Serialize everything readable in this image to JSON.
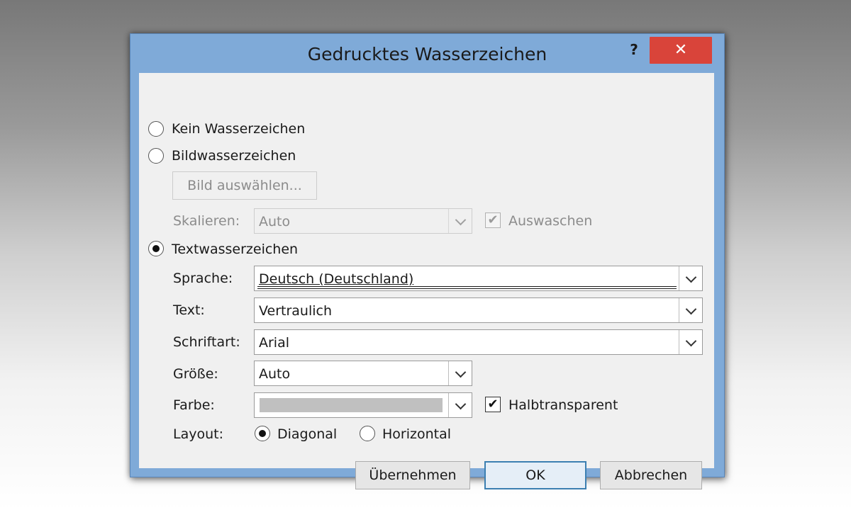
{
  "dialog": {
    "title": "Gedrucktes Wasserzeichen",
    "help": "?",
    "close": "✕"
  },
  "options": {
    "no_watermark": "Kein Wasserzeichen",
    "image_watermark": "Bildwasserzeichen",
    "select_image_button": "Bild auswählen...",
    "scale_label": "Skalieren:",
    "scale_value": "Auto",
    "washout_label": "Auswaschen",
    "washout_checked": true,
    "text_watermark": "Textwasserzeichen",
    "selected": "text_watermark"
  },
  "text_fields": {
    "language_label": "Sprache:",
    "language_value": "Deutsch (Deutschland)",
    "text_label": "Text:",
    "text_value": "Vertraulich",
    "font_label": "Schriftart:",
    "font_value": "Arial",
    "size_label": "Größe:",
    "size_value": "Auto",
    "color_label": "Farbe:",
    "color_value": "#c0c0c0",
    "semitransparent_label": "Halbtransparent",
    "semitransparent_checked": true,
    "layout_label": "Layout:",
    "layout_diagonal": "Diagonal",
    "layout_horizontal": "Horizontal",
    "layout_selected": "diagonal"
  },
  "buttons": {
    "apply": "Übernehmen",
    "ok": "OK",
    "cancel": "Abbrechen"
  },
  "colors": {
    "title_bar": "#7faad8",
    "close_button": "#d9443a",
    "client_background": "#f0f0f0"
  }
}
